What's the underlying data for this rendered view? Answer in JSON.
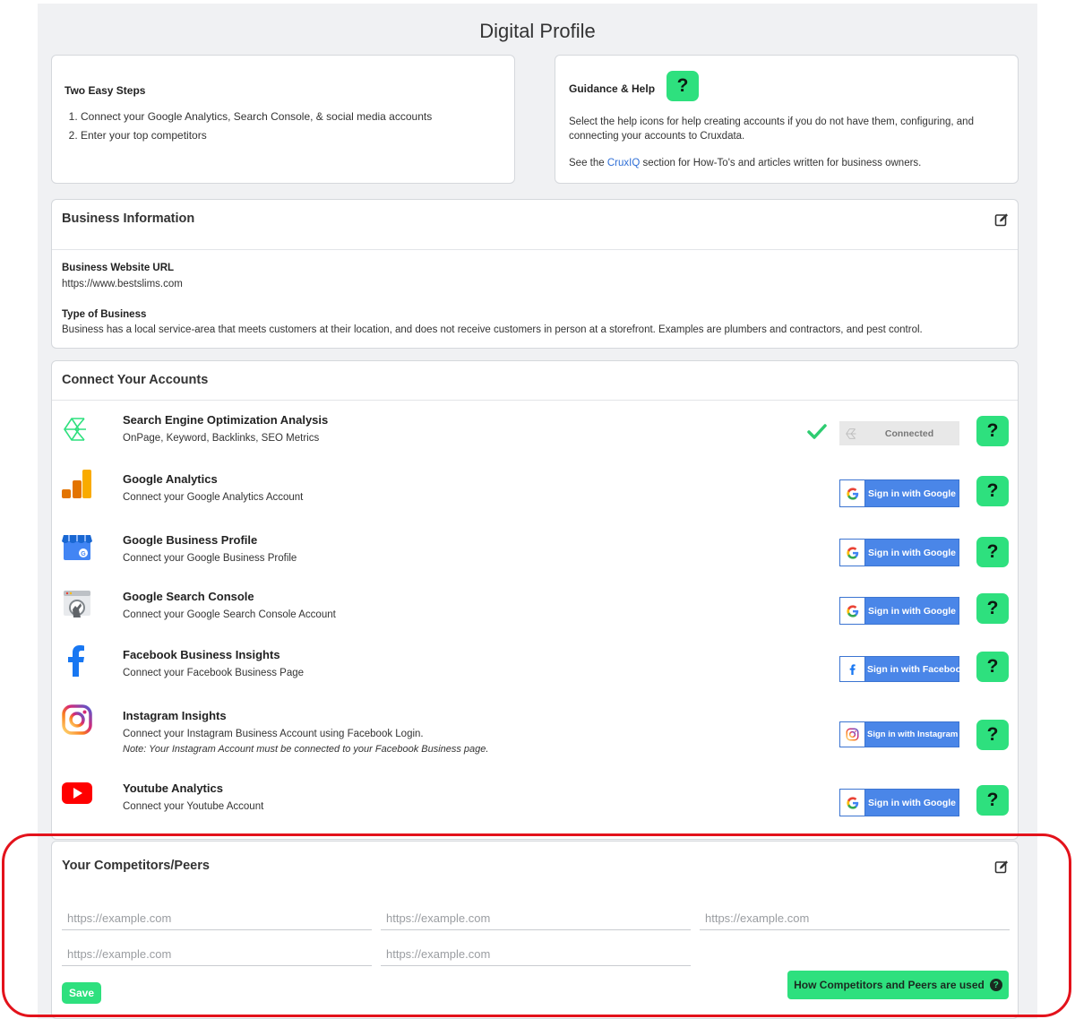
{
  "page": {
    "title": "Digital Profile"
  },
  "steps": {
    "heading": "Two Easy Steps",
    "items": [
      "Connect your Google Analytics, Search Console, & social media accounts",
      "Enter your top competitors"
    ]
  },
  "guidance": {
    "heading": "Guidance & Help",
    "help_label": "?",
    "paragraph1": "Select the help icons for help creating accounts if you do not have them, configuring, and connecting your accounts to Cruxdata.",
    "paragraph2_before": "See the ",
    "paragraph2_link": "CruxIQ",
    "paragraph2_after": " section for How-To's and articles written for business owners."
  },
  "business": {
    "heading": "Business Information",
    "url_label": "Business Website URL",
    "url_value": "https://www.bestslims.com",
    "type_label": "Type of Business",
    "type_value": "Business has a local service-area that meets customers at their location, and does not receive customers in person at a storefront. Examples are plumbers and contractors, and pest control."
  },
  "accounts": {
    "heading": "Connect Your Accounts",
    "help_label": "?",
    "items": [
      {
        "title": "Search Engine Optimization Analysis",
        "subtitle": "OnPage, Keyword, Backlinks, SEO Metrics",
        "note": "",
        "button": "Connected",
        "icon": "cruxdata-logo-icon"
      },
      {
        "title": "Google Analytics",
        "subtitle": "Connect your Google Analytics Account",
        "note": "",
        "button": "Sign in with Google",
        "icon": "google-analytics-icon"
      },
      {
        "title": "Google Business Profile",
        "subtitle": "Connect your Google Business Profile",
        "note": "",
        "button": "Sign in with Google",
        "icon": "google-business-icon"
      },
      {
        "title": "Google Search Console",
        "subtitle": "Connect your Google Search Console Account",
        "note": "",
        "button": "Sign in with Google",
        "icon": "search-console-icon"
      },
      {
        "title": "Facebook Business Insights",
        "subtitle": "Connect your Facebook Business Page",
        "note": "",
        "button": "Sign in with Facebook",
        "icon": "facebook-icon"
      },
      {
        "title": "Instagram Insights",
        "subtitle": "Connect your Instagram Business Account using Facebook Login.",
        "note": "Note: Your Instagram Account must be connected to your Facebook Business page.",
        "button": "Sign in with Instagram",
        "icon": "instagram-icon"
      },
      {
        "title": "Youtube Analytics",
        "subtitle": "Connect your Youtube Account",
        "note": "",
        "button": "Sign in with Google",
        "icon": "youtube-icon"
      }
    ]
  },
  "competitors": {
    "heading": "Your Competitors/Peers",
    "placeholder": "https://example.com",
    "save_label": "Save",
    "how_label": "How Competitors and Peers are used",
    "how_icon": "?"
  },
  "colors": {
    "accent": "#2ee07e",
    "google_blue": "#4a86e8",
    "highlight": "#e3121b",
    "link": "#2f6fd6"
  }
}
